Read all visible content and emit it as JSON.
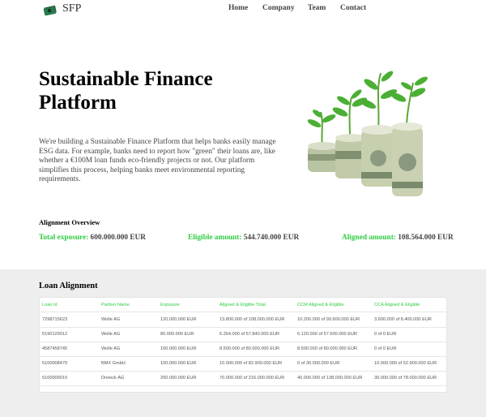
{
  "brand": {
    "name": "SFP",
    "icon": "money-icon"
  },
  "nav": [
    "Home",
    "Company",
    "Team",
    "Contact"
  ],
  "hero": {
    "title": "Sustainable Finance Platform",
    "text": "We're building a Sustainable Finance Platform that helps banks easily manage ESG data. For example, banks need to report how \"green\" their loans are, like whether a €100M loan funds eco-friendly projects or not. Our platform simplifies this process, helping banks meet environmental reporting requirements.",
    "image_icon": "money-stacks-with-plants-icon"
  },
  "overview": {
    "title": "Alignment Overview",
    "items": [
      {
        "label": "Total exposure:",
        "value": "600.000.000 EUR"
      },
      {
        "label": "Eligible amount:",
        "value": "544.740.000 EUR"
      },
      {
        "label": "Aligned amount:",
        "value": "108.564.000 EUR"
      }
    ]
  },
  "loans": {
    "title": "Loan Alignment",
    "headers": [
      "Loan Id",
      "Partner Name",
      "Exposure",
      "Aligned & Eligible Total",
      "CCM Aligned & Eligible",
      "CCA Aligned & Eligible"
    ],
    "rows": [
      [
        "7298715623",
        "Wolle AG",
        "120.000.000 EUR",
        "13.800.000 of 108.000.000 EUR",
        "10.200.000 of 99.600.000 EUR",
        "3.600.000 of 8.400.000 EUR"
      ],
      [
        "5190129012",
        "Wolle AG",
        "80.000.000 EUR",
        "6.264.000 of 57.840.000 EUR",
        "6.120.000 of 57.600.000 EUR",
        "0 of 0 EUR"
      ],
      [
        "4587458745",
        "Wolle AG",
        "100.000.000 EUR",
        "8.500.000 of 80.000.000 EUR",
        "8.500.000 of 80.000.000 EUR",
        "0 of 0 EUR"
      ],
      [
        "5100008470",
        "BMX GmbH",
        "100.000.000 EUR",
        "10.000.000 of 82.900.000 EUR",
        "0 of 30.000.000 EUR",
        "10.000.000 of 52.900.000 EUR"
      ],
      [
        "5100009010",
        "Dreieck AG",
        "200.000.000 EUR",
        "70.000.000 of 216.000.000 EUR",
        "40.000.000 of 138.000.000 EUR",
        "30.000.000 of 78.000.000 EUR"
      ]
    ]
  },
  "colors": {
    "accent_green": "#2ecc40",
    "section_gray": "#eeeeee"
  }
}
